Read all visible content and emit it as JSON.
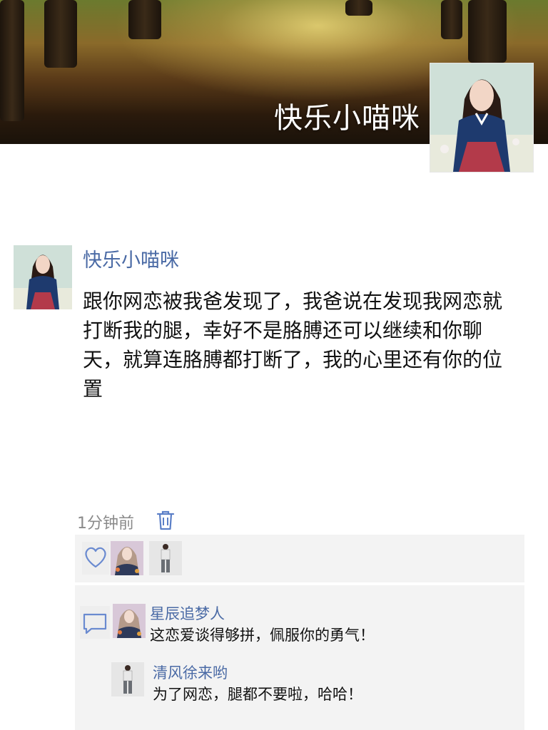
{
  "profile": {
    "cover_name": "快乐小喵咪",
    "colors": {
      "link": "#4a6aa5",
      "text": "#111111",
      "muted": "#8a8a8a",
      "panel": "#f3f3f3"
    }
  },
  "post": {
    "author": "快乐小喵咪",
    "content": "跟你网恋被我爸发现了，我爸说在发现我网恋就打断我的腿，幸好不是胳膊还可以继续和你聊天，就算连胳膊都打断了，我的心里还有你的位置",
    "time": "1分钟前",
    "icons": {
      "delete": "trash-icon",
      "like": "heart-icon",
      "comment": "comment-bubble-icon"
    }
  },
  "comments": [
    {
      "author": "星辰追梦人",
      "text": "这恋爱谈得够拼，佩服你的勇气！"
    },
    {
      "author": "清风徐来哟",
      "text": "为了网恋，腿都不要啦，哈哈！"
    }
  ]
}
